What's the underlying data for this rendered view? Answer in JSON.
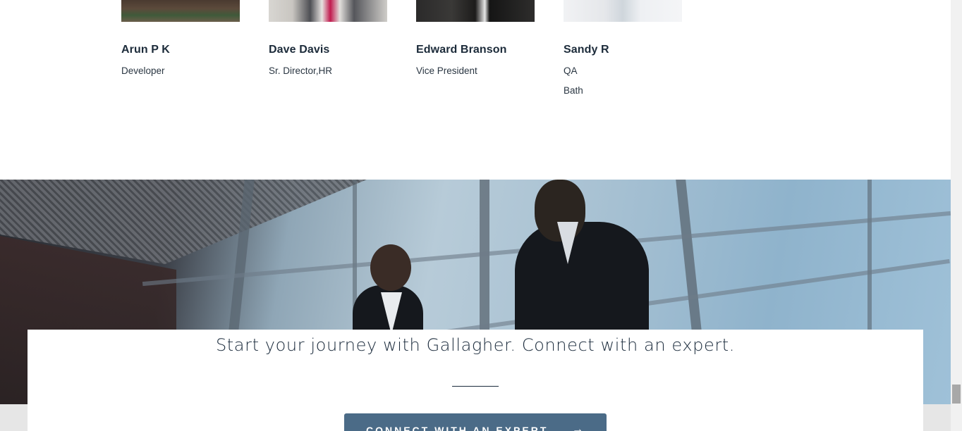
{
  "team": {
    "members": [
      {
        "name": "Arun P K",
        "role": "Developer",
        "location": ""
      },
      {
        "name": "Dave Davis",
        "role": "Sr. Director,HR",
        "location": ""
      },
      {
        "name": "Edward Branson",
        "role": "Vice President",
        "location": ""
      },
      {
        "name": "Sandy R",
        "role": "QA",
        "location": "Bath"
      }
    ]
  },
  "cta": {
    "title": "Start your journey with Gallagher. Connect with an expert.",
    "button_label": "CONNECT WITH AN EXPERT",
    "button_arrow": "→"
  },
  "colors": {
    "accent": "#4b6b87",
    "text": "#1b2b3c"
  }
}
